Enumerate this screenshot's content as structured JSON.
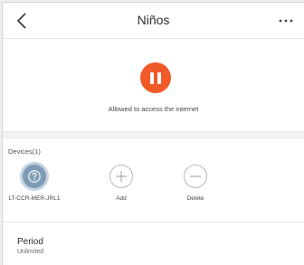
{
  "header": {
    "title": "Niños",
    "back_icon": "chevron-left-icon",
    "more_icon": "more-horizontal-icon"
  },
  "status": {
    "message": "Allowed to access the internet",
    "button_icon": "pause-icon",
    "accent_color": "#f05a28"
  },
  "devices": {
    "heading": "Devices(1)",
    "items": [
      {
        "label": "LT-CCR-MER-JRL1",
        "icon": "question-mark-icon"
      },
      {
        "label": "Add",
        "icon": "plus-icon"
      },
      {
        "label": "Delete",
        "icon": "minus-icon"
      }
    ]
  },
  "period": {
    "label": "Period",
    "value": "Unlimited"
  }
}
